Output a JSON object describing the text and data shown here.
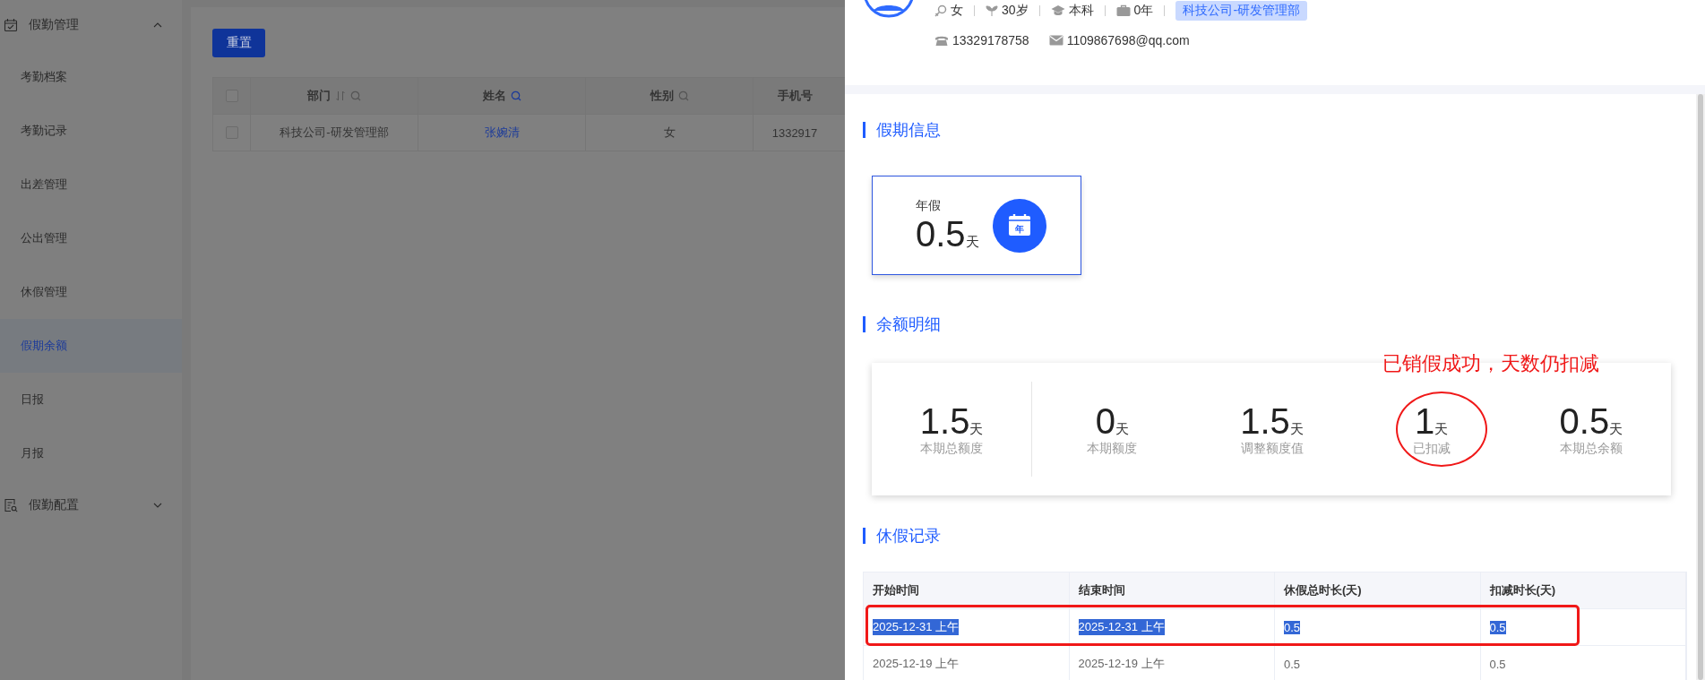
{
  "sidebar": {
    "groups": [
      {
        "label": "假勤管理",
        "expanded": true,
        "children": [
          {
            "label": "考勤档案",
            "selected": false
          },
          {
            "label": "考勤记录",
            "selected": false
          },
          {
            "label": "出差管理",
            "selected": false
          },
          {
            "label": "公出管理",
            "selected": false
          },
          {
            "label": "休假管理",
            "selected": false
          },
          {
            "label": "假期余额",
            "selected": true
          },
          {
            "label": "日报",
            "selected": false
          },
          {
            "label": "月报",
            "selected": false
          }
        ]
      },
      {
        "label": "假勤配置",
        "expanded": false
      }
    ]
  },
  "toolbar": {
    "reset_button": "重置"
  },
  "table": {
    "header_checked": false,
    "columns": [
      {
        "label": "部门",
        "kind": "sort_search"
      },
      {
        "label": "姓名",
        "kind": "search_active"
      },
      {
        "label": "性别",
        "kind": "search"
      },
      {
        "label": "手机号",
        "kind": "plain"
      }
    ],
    "rows": [
      {
        "checked": false,
        "cells": [
          {
            "text": "科技公司-研发管理部",
            "link": false
          },
          {
            "text": "张婉清",
            "link": true
          },
          {
            "text": "女",
            "link": false
          },
          {
            "text": "1332917",
            "link": false
          }
        ]
      }
    ]
  },
  "drawer": {
    "profile": {
      "gender": "女",
      "age": "30岁",
      "education": "本科",
      "experience": "0年",
      "department": "科技公司-研发管理部",
      "phone": "13329178758",
      "email": "1109867698@qq.com"
    },
    "leave_info": {
      "title": "假期信息",
      "cards": [
        {
          "name": "年假",
          "value": "0.5",
          "unit": "天",
          "badge": "年"
        }
      ]
    },
    "balance": {
      "title": "余额明细",
      "annotation": "已销假成功，天数仍扣减",
      "items": [
        {
          "value": "1.5",
          "unit": "天",
          "label": "本期总额度",
          "circled": false
        },
        {
          "value": "0",
          "unit": "天",
          "label": "本期额度",
          "circled": false
        },
        {
          "value": "1.5",
          "unit": "天",
          "label": "调整额度值",
          "circled": false
        },
        {
          "value": "1",
          "unit": "天",
          "label": "已扣减",
          "circled": true
        },
        {
          "value": "0.5",
          "unit": "天",
          "label": "本期总余额",
          "circled": false
        }
      ]
    },
    "records": {
      "title": "休假记录",
      "columns": [
        "开始时间",
        "结束时间",
        "休假总时长(天)",
        "扣减时长(天)"
      ],
      "rows": [
        {
          "highlighted": true,
          "text_selected": true,
          "cells": [
            "2025-12-31 上午",
            "2025-12-31 上午",
            "0.5",
            "0.5"
          ]
        },
        {
          "highlighted": false,
          "text_selected": false,
          "cells": [
            "2025-12-19 上午",
            "2025-12-19 上午",
            "0.5",
            "0.5"
          ]
        }
      ]
    }
  }
}
